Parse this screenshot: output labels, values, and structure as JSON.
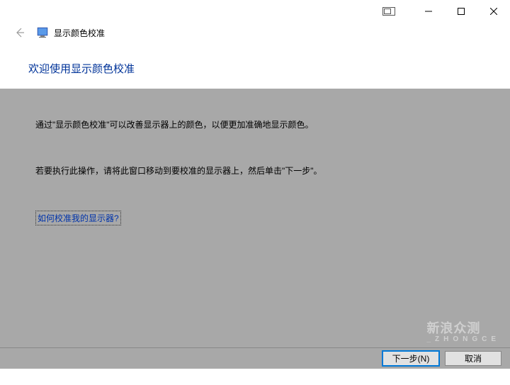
{
  "titlebar": {
    "minimize": "─",
    "maximize": "☐",
    "close": "✕"
  },
  "header": {
    "app_title": "显示颜色校准"
  },
  "page": {
    "heading": "欢迎使用显示颜色校准"
  },
  "content": {
    "p1": "通过\"显示颜色校准\"可以改善显示器上的颜色，以便更加准确地显示颜色。",
    "p2": "若要执行此操作，请将此窗口移动到要校准的显示器上，然后单击\"下一步\"。",
    "help_link": "如何校准我的显示器?"
  },
  "buttons": {
    "next": "下一步(N)",
    "cancel": "取消"
  },
  "watermark": {
    "main": "新浪众测",
    "sub": "_ZHONGCE"
  }
}
